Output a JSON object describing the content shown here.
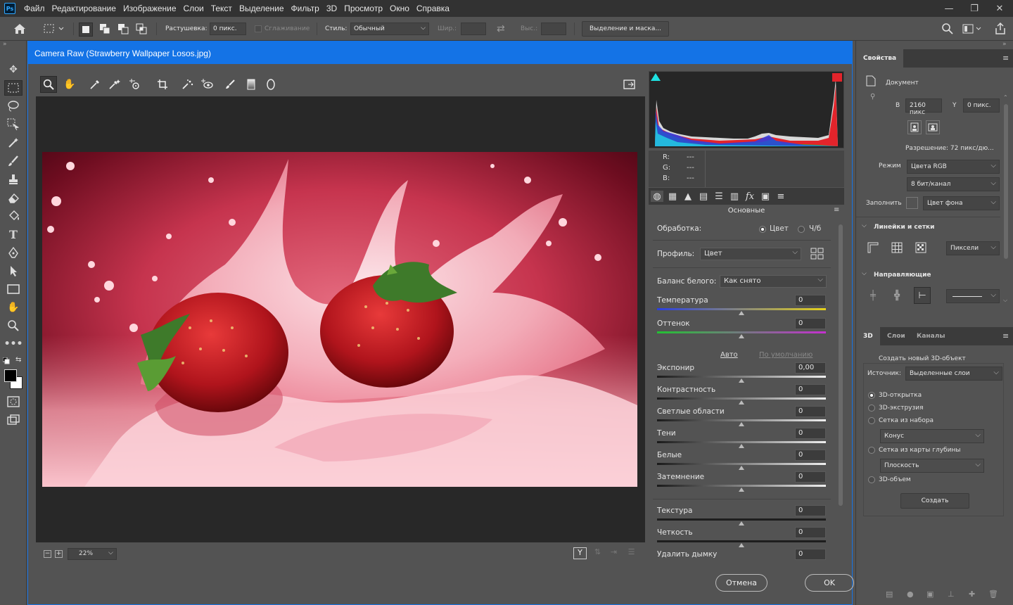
{
  "app": {
    "logo": "Ps"
  },
  "menu": [
    "Файл",
    "Редактирование",
    "Изображение",
    "Слои",
    "Текст",
    "Выделение",
    "Фильтр",
    "3D",
    "Просмотр",
    "Окно",
    "Справка"
  ],
  "window_controls": {
    "minimize": "—",
    "restore": "❐",
    "close": "✕"
  },
  "options_bar": {
    "feather_label": "Растушевка:",
    "feather_value": "0 пикс.",
    "antialias_label": "Сглаживание",
    "style_label": "Стиль:",
    "style_value": "Обычный",
    "width_label": "Шир.:",
    "height_label": "Выс.:",
    "mask_button": "Выделение и маска..."
  },
  "dialog": {
    "title": "Camera Raw (Strawberry Wallpaper Losos.jpg)",
    "zoom": "22%",
    "cancel": "Отмена",
    "ok": "OK",
    "view_mode": "Y"
  },
  "rgb_readout": {
    "r_label": "R:",
    "g_label": "G:",
    "b_label": "B:",
    "r": "---",
    "g": "---",
    "b": "---"
  },
  "adjust": {
    "section": "Основные",
    "treatment_label": "Обработка:",
    "treatment_color": "Цвет",
    "treatment_bw": "Ч/б",
    "profile_label": "Профиль:",
    "profile_value": "Цвет",
    "wb_label": "Баланс белого:",
    "wb_value": "Как снято",
    "auto": "Авто",
    "default": "По умолчанию",
    "sliders_top": [
      {
        "label": "Температура",
        "value": "0"
      },
      {
        "label": "Оттенок",
        "value": "0"
      }
    ],
    "sliders_tone": [
      {
        "label": "Экспонир",
        "value": "0,00"
      },
      {
        "label": "Контрастность",
        "value": "0"
      },
      {
        "label": "Светлые области",
        "value": "0"
      },
      {
        "label": "Тени",
        "value": "0"
      },
      {
        "label": "Белые",
        "value": "0"
      },
      {
        "label": "Затемнение",
        "value": "0"
      }
    ],
    "sliders_presence": [
      {
        "label": "Текстура",
        "value": "0"
      },
      {
        "label": "Четкость",
        "value": "0"
      },
      {
        "label": "Удалить дымку",
        "value": "0"
      }
    ]
  },
  "properties": {
    "tab": "Свойства",
    "doc_label": "Документ",
    "w_label": "В",
    "w_value": "2160 пикс",
    "h_label": "Y",
    "h_value": "0 пикс.",
    "resolution": "Разрешение: 72 пикс/дю...",
    "mode_label": "Режим",
    "mode_value": "Цвета RGB",
    "depth_value": "8 бит/канал",
    "fill_label": "Заполнить",
    "fill_value": "Цвет фона",
    "rulers_title": "Линейки и сетки",
    "rulers_unit": "Пиксели",
    "guides_title": "Направляющие"
  },
  "panel3d": {
    "tabs": [
      "3D",
      "Слои",
      "Каналы"
    ],
    "create_title": "Создать новый 3D-объект",
    "source_label": "Источник:",
    "source_value": "Выделенные слои",
    "options": [
      "3D-открытка",
      "3D-экструзия",
      "Сетка из набора",
      "Сетка из карты глубины",
      "3D-объем"
    ],
    "preset_value": "Конус",
    "depth_value": "Плоскость",
    "create_button": "Создать"
  },
  "colors": {
    "accent": "#1473e6",
    "bg": "#535353",
    "dark": "#323232"
  }
}
